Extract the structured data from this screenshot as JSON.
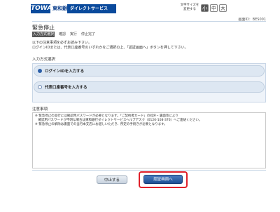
{
  "header": {
    "logo_text": "TOWA",
    "bank_name": "東和銀行",
    "service_name": "ダイレクトサービス",
    "font_size_label": "文字サイズを変更する",
    "font_sizes": [
      "小",
      "中",
      "大"
    ]
  },
  "screen_id": "画面ID：BES001",
  "page_title": "緊急停止",
  "steps": [
    "入力方式選択",
    "確認",
    "実行",
    "停止完了"
  ],
  "intro": {
    "line1": "以下の注意事項を必ずお読み下さい。",
    "line2": "ログインIDまたは、代表口座番号のいずれかをご選択の上、「認証画面へ」ボタンを押して下さい。"
  },
  "input_method_label": "入力方式選択",
  "options": [
    {
      "label": "ログインIDを入力する",
      "selected": true
    },
    {
      "label": "代表口座番号を入力する",
      "selected": false
    }
  ],
  "notes_label": "注意事項",
  "notes": [
    "※ 緊急停止の実行には確認用パスワードが必要となります。「ご契約者カード」の枠外・裏面等により",
    "　確認用パスワードが不明な場合は東和銀行ダイレクトサービスヘルプデスク（0120-108-376）へご連絡ください。",
    "※ 緊急停止の解除は書面での当行本支店にお越しいただき、所定の手続きが必要となります。"
  ],
  "buttons": {
    "cancel": "中止する",
    "confirm": "認証画面へ"
  }
}
